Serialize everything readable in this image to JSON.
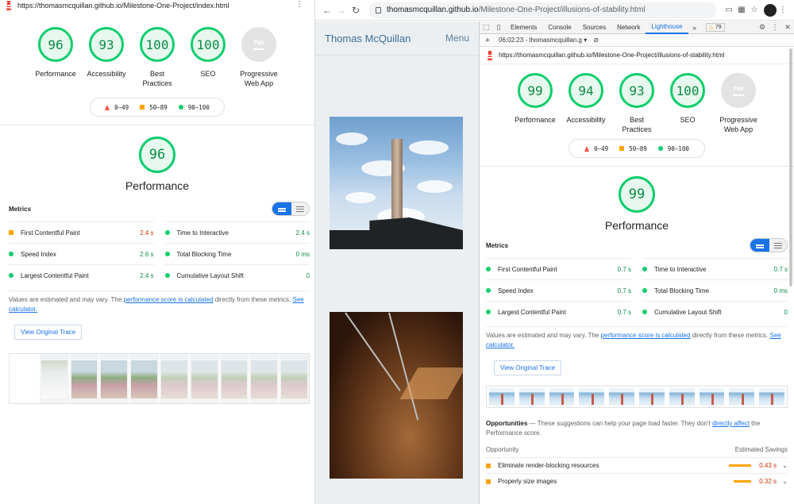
{
  "left": {
    "url": "https://thomasmcquillan.github.io/Milestone-One-Project/index.html",
    "gauges": [
      {
        "score": "96",
        "label": "Performance"
      },
      {
        "score": "93",
        "label": "Accessibility"
      },
      {
        "score": "100",
        "label": "Best Practices"
      },
      {
        "score": "100",
        "label": "SEO"
      }
    ],
    "pwa": {
      "badge": "PWA",
      "label": "Progressive Web App"
    },
    "performance": {
      "score": "96",
      "title": "Performance"
    },
    "metrics_title": "Metrics",
    "metrics": [
      {
        "name": "First Contentful Paint",
        "value": "2.4 s",
        "status": "orange"
      },
      {
        "name": "Time to Interactive",
        "value": "2.4 s",
        "status": "green"
      },
      {
        "name": "Speed Index",
        "value": "2.6 s",
        "status": "green"
      },
      {
        "name": "Total Blocking Time",
        "value": "0 ms",
        "status": "green"
      },
      {
        "name": "Largest Contentful Paint",
        "value": "2.4 s",
        "status": "green"
      },
      {
        "name": "Cumulative Layout Shift",
        "value": "0",
        "status": "green"
      }
    ]
  },
  "legend": {
    "red": "0–49",
    "orange": "50–89",
    "green": "90–100"
  },
  "note": {
    "prefix": "Values are estimated and may vary. The ",
    "link1": "performance score is calculated",
    "mid": " directly from these metrics. ",
    "link2": "See calculator."
  },
  "trace_button": "View Original Trace",
  "browser": {
    "url_host": "thomasmcquillan.github.io",
    "url_path": "/Milestone-One-Project/illusions-of-stability.html"
  },
  "site": {
    "title": "Thomas McQuillan",
    "menu": "Menu"
  },
  "devtools": {
    "tabs": [
      "Elements",
      "Console",
      "Sources",
      "Network",
      "Lighthouse"
    ],
    "more": "»",
    "warnings": "79",
    "report_select": "06:02:23 - thomasmcquillan.g",
    "url": "https://thomasmcquillan.github.io/Milestone-One-Project/illusions-of-stability.html",
    "gauges": [
      {
        "score": "99",
        "label": "Performance"
      },
      {
        "score": "94",
        "label": "Accessibility"
      },
      {
        "score": "93",
        "label": "Best Practices"
      },
      {
        "score": "100",
        "label": "SEO"
      }
    ],
    "pwa": {
      "badge": "PWA",
      "label": "Progressive Web App"
    },
    "performance": {
      "score": "99",
      "title": "Performance"
    },
    "metrics_title": "Metrics",
    "metrics": [
      {
        "name": "First Contentful Paint",
        "value": "0.7 s",
        "status": "green"
      },
      {
        "name": "Time to Interactive",
        "value": "0.7 s",
        "status": "green"
      },
      {
        "name": "Speed Index",
        "value": "0.7 s",
        "status": "green"
      },
      {
        "name": "Total Blocking Time",
        "value": "0 ms",
        "status": "green"
      },
      {
        "name": "Largest Contentful Paint",
        "value": "0.7 s",
        "status": "green"
      },
      {
        "name": "Cumulative Layout Shift",
        "value": "0",
        "status": "green"
      }
    ],
    "opportunities": {
      "title": "Opportunities",
      "dash": " — ",
      "desc": "These suggestions can help your page load faster. They don't ",
      "link": "directly affect",
      "desc2": " the Performance score.",
      "col_opportunity": "Opportunity",
      "col_savings": "Estimated Savings",
      "items": [
        {
          "name": "Eliminate render-blocking resources",
          "value": "0.43 s"
        },
        {
          "name": "Properly size images",
          "value": "0.32 s"
        }
      ]
    }
  },
  "colors": {
    "green": "#0cce6b",
    "orange": "#ffa400",
    "red": "#ff4e42",
    "blue": "#1a73e8"
  }
}
